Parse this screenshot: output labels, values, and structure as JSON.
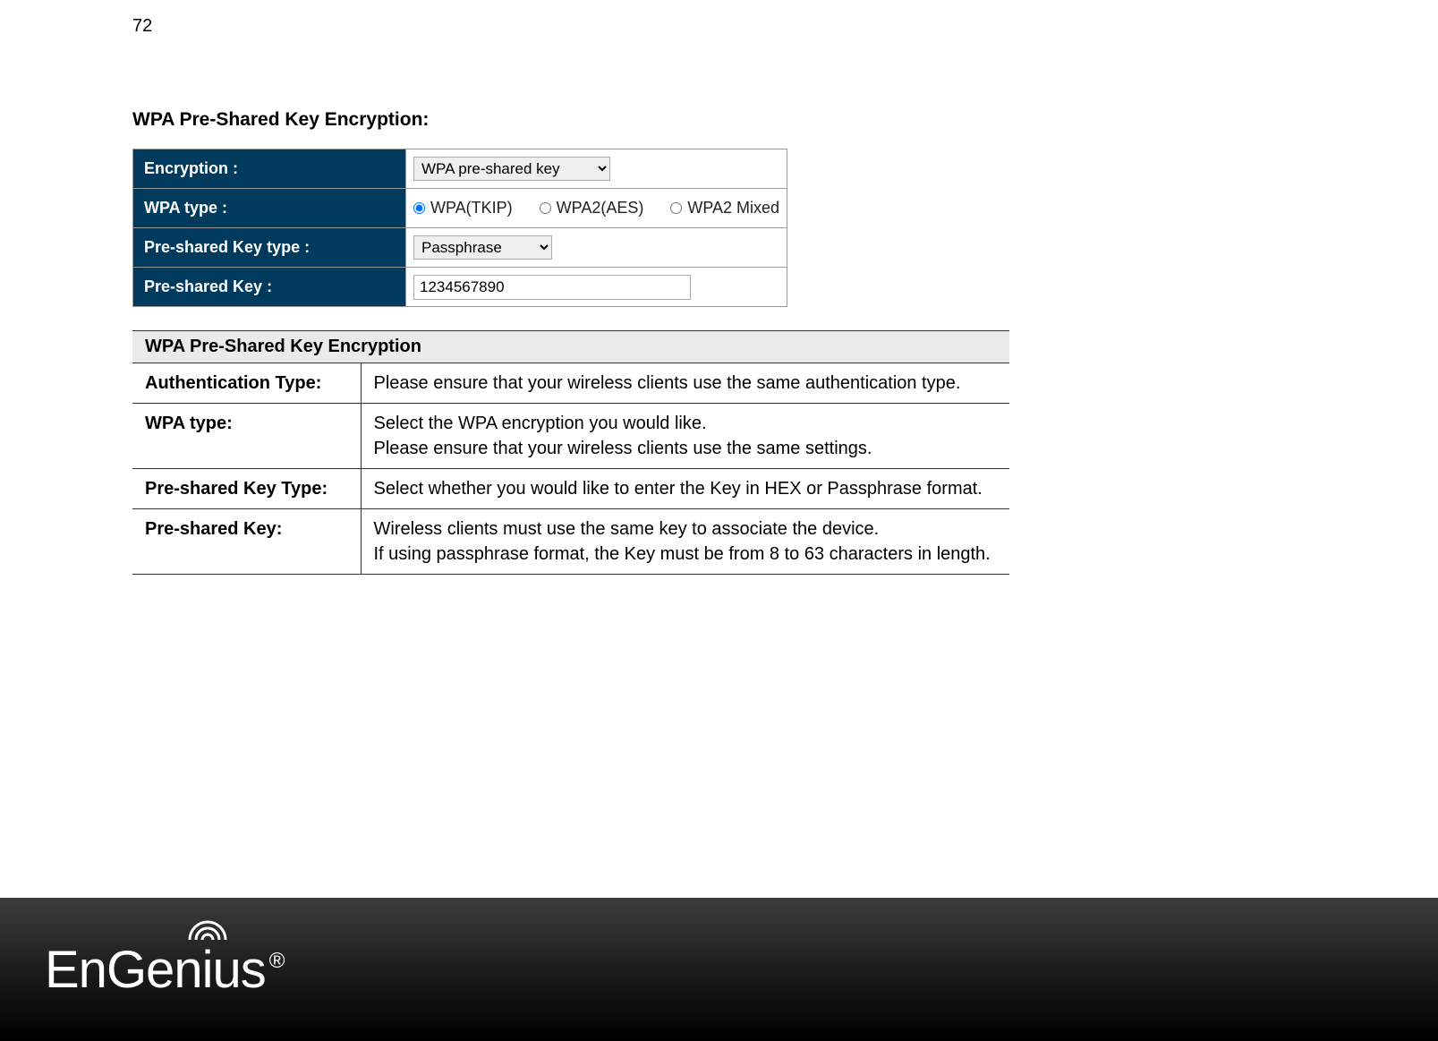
{
  "page_number": "72",
  "section_title": "WPA Pre-Shared Key Encryption:",
  "config": {
    "encryption": {
      "label": "Encryption :",
      "selected": "WPA pre-shared key"
    },
    "wpa_type": {
      "label": "WPA type :",
      "options": [
        {
          "label": "WPA(TKIP)",
          "checked": true
        },
        {
          "label": "WPA2(AES)",
          "checked": false
        },
        {
          "label": "WPA2 Mixed",
          "checked": false
        }
      ]
    },
    "psk_type": {
      "label": "Pre-shared Key type :",
      "selected": "Passphrase"
    },
    "psk": {
      "label": "Pre-shared Key :",
      "value": "1234567890"
    }
  },
  "desc": {
    "header": "WPA Pre-Shared Key Encryption",
    "rows": [
      {
        "name": "Authentication Type:",
        "text": "Please ensure that your wireless clients use the same authentication type."
      },
      {
        "name": "WPA type:",
        "text": "Select the WPA encryption you would like.\nPlease ensure that your wireless clients use the same settings."
      },
      {
        "name": "Pre-shared Key Type:",
        "text": "Select whether you would like to enter the Key in HEX or Passphrase format."
      },
      {
        "name": "Pre-shared Key:",
        "text": "Wireless clients must use the same key to associate the device.\nIf using passphrase format, the Key must be from 8 to 63 characters in length."
      }
    ]
  },
  "footer": {
    "brand": "EnGenius",
    "reg": "®"
  }
}
